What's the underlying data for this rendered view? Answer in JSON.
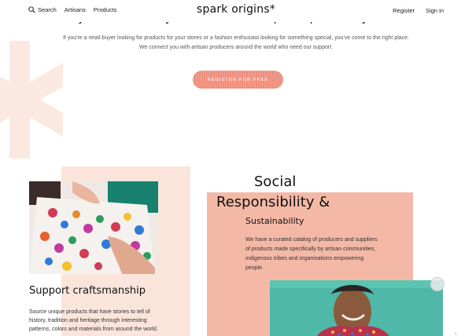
{
  "header": {
    "search_label": "Search",
    "nav_left": [
      "Artisans",
      "Products"
    ],
    "brand": "spark origins*",
    "register": "Register",
    "signin": "Sign in"
  },
  "hero": {
    "heading": "Buy wholesale for your brand or one special piece for yourself.",
    "desc_line1": "If you're a retail buyer looking for products for your stores or a fashion enthusiast looking for something special, you've come to the right place.",
    "desc_line2": "We connect you with artisan producers around the world who need our support.",
    "cta": "REGISTER FOR FREE"
  },
  "craft": {
    "title": "Support craftsmanship",
    "desc": "Source unique products that have stories to tell of history, tradition and heritage through interesting patterns, colors and materials from around the world."
  },
  "responsibility": {
    "title_line1": "Social",
    "title_line2": "Responsibility &",
    "subtitle": "Sustainability",
    "desc": "We have a curated catalog of producers and suppliers of products made specifically by artisan communities, indigenous tribes and organisations empowering people."
  },
  "colors": {
    "accent": "#ef8a78",
    "peach": "#fbe5da",
    "salmon": "#f4b9a6"
  }
}
